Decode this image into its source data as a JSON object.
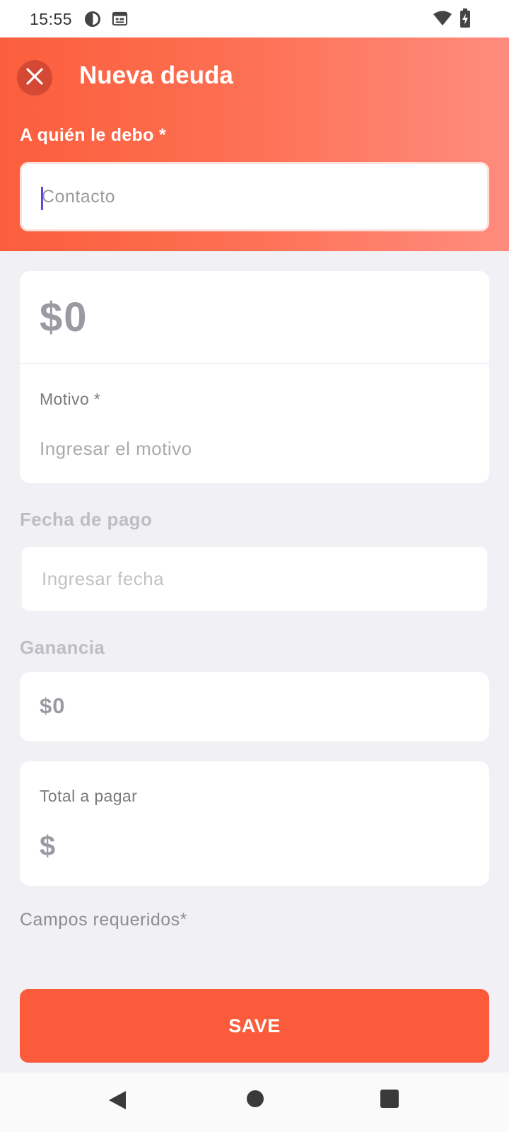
{
  "status_bar": {
    "time": "15:55",
    "left_icons": [
      "sync-icon",
      "calendar-icon"
    ],
    "right_icons": [
      "wifi-icon",
      "battery-charging-icon"
    ]
  },
  "header": {
    "title": "Nueva deuda",
    "close_icon": "close-icon",
    "contact_label": "A quién le debo *",
    "contact_placeholder": "Contacto"
  },
  "amount": {
    "value": "$0",
    "reason_label": "Motivo *",
    "reason_placeholder": "Ingresar el motivo"
  },
  "payment_date": {
    "label": "Fecha de pago",
    "placeholder": "Ingresar fecha"
  },
  "profit": {
    "label": "Ganancia",
    "value": "$0"
  },
  "total": {
    "label": "Total a pagar",
    "value": "$"
  },
  "required_note": "Campos requeridos*",
  "save_label": "SAVE",
  "colors": {
    "accent": "#fb5b3a",
    "header_gradient_end": "#ff8c7e",
    "background": "#f0f0f5"
  },
  "nav_bar": [
    "back-icon",
    "home-icon",
    "recents-icon"
  ]
}
